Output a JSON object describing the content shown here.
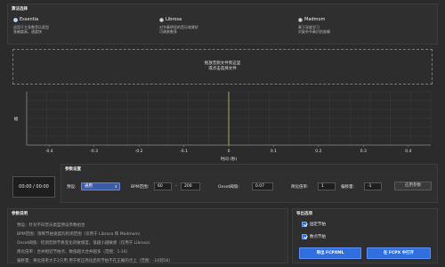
{
  "algorithm": {
    "title": "算法选择",
    "options": [
      {
        "name": "Essentia",
        "desc1": "适用于大多数音乐类型",
        "desc2": "准确度高，速度快",
        "checked": true
      },
      {
        "name": "Librosa",
        "desc1": "对节奏明显的音乐效果好",
        "desc2": "可调参数多",
        "checked": false
      },
      {
        "name": "Madmom",
        "desc1": "基于深度学习",
        "desc2": "对复杂节奏识别准确",
        "checked": false
      }
    ]
  },
  "dropzone": {
    "line1": "拖放音频文件到这里",
    "line2": "或点击选择文件"
  },
  "chart_data": {
    "type": "line",
    "xlabel": "时间 (秒)",
    "ylabel": "幅",
    "x_ticks": [
      "-0.4",
      "-0.3",
      "-0.2",
      "-0.1",
      "0",
      "0.1",
      "0.2",
      "0.3",
      "0.4"
    ],
    "xlim": [
      -0.45,
      0.45
    ],
    "grid": true,
    "series": [
      {
        "values": []
      }
    ],
    "markers": [
      0
    ],
    "colors": {
      "marker": "#c9c96a",
      "grid": "#3d3d3d",
      "axis": "#8a8a8a"
    }
  },
  "time_display": "00:00 / 00:00",
  "params": {
    "title": "参数设置",
    "preset_label": "预设:",
    "preset_value": "通用",
    "bpm_label": "BPM范围:",
    "bpm_min": "60",
    "bpm_dash": "-",
    "bpm_max": "200",
    "onset_label": "Onset阈值:",
    "onset_value": "0.07",
    "simplify_label": "简化倍率:",
    "simplify_value": "1",
    "offset_label": "偏移量:",
    "offset_value": "-1",
    "apply_label": "应用参数"
  },
  "notes": {
    "title": "参数说明",
    "lines": [
      "预设：针对不同音乐类型预设参数组合",
      "BPM范围：限制节拍速度的检测范围（仅用于 Librosa 和 Madmom）",
      "Onset阈值：检测音频节奏变化的敏感度，值越小越敏感（仅用于 Librosa）",
      "简化倍率：合并相近节拍点，数值越大合并越多（范围：1-16）",
      "偏移量：将化倍率大于2只用 用于修正简化后的节拍不在正确的点上（范围：-16到16）"
    ]
  },
  "export": {
    "title": "导出选项",
    "fixed_label": "固定节拍",
    "marker_label": "数点节拍",
    "fcpxml_label": "导出 FCPXML",
    "fcpx_open_label": "在 FCPX 中打开"
  }
}
